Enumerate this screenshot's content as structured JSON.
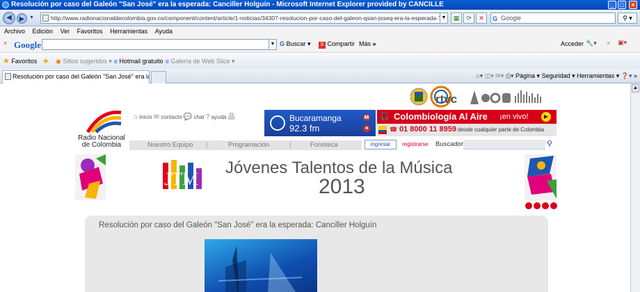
{
  "window": {
    "title": "Resolución por caso del Galeón \"San José\" era la esperada: Canciller Holguín - Microsoft Internet Explorer provided by CANCILLE"
  },
  "address_bar": {
    "url": "http://www.radionacionaldecolombia.gov.co/component/content/article/1-noticias/34307-resolucion-por-caso-del-galeon-qsan-joseq-era-la-esperada-?utm_medi",
    "search_placeholder": "Google"
  },
  "menu_bar": {
    "items": [
      "Archivo",
      "Edición",
      "Ver",
      "Favoritos",
      "Herramientas",
      "Ayuda"
    ]
  },
  "google_toolbar": {
    "logo": "Google",
    "buscar": "Buscar",
    "compartir": "Compartir",
    "mas": "Más",
    "acceder": "Acceder"
  },
  "favorites_bar": {
    "favoritos": "Favoritos",
    "items": [
      "Sitios sugeridos",
      "Hotmail gratuito",
      "Galería de Web Slice"
    ]
  },
  "tabs": {
    "active_title": "Resolución por caso del Galeón \"San José\" era la espera..."
  },
  "command_bar": {
    "pagina": "Página",
    "seguridad": "Seguridad",
    "herramientas": "Herramientas"
  },
  "site": {
    "logo_line1": "Radio Nacional",
    "logo_line2": "de Colombia",
    "rtvc": "rtvc",
    "top_links": [
      "inicio",
      "contacto",
      "chat",
      "ayuda"
    ],
    "station_name": "Bucaramanga",
    "station_freq": "92.3 fm",
    "promo_title": "Colombiología Al Aire",
    "promo_live": "¡en vivo!",
    "promo_phone": "01 8000 11 8959",
    "promo_sub": "desde cualquier parte de Colombia",
    "nav": [
      "Nuestro Equipo",
      "Programación",
      "Fonoteca"
    ],
    "login": "ingresar",
    "register": "registrarse",
    "search_label": "Buscador",
    "hero_logo": "JTM",
    "hero_title": "Jóvenes Talentos de la Música",
    "hero_year": "2013",
    "article_title": "Resolución por caso del Galeón \"San José\" era la esperada: Canciller Holguín"
  },
  "colors": {
    "ie_blue": "#0547b6",
    "promo_red": "#d7001a",
    "station_blue": "#1a3f99",
    "article_bg": "#e8e8e8"
  }
}
